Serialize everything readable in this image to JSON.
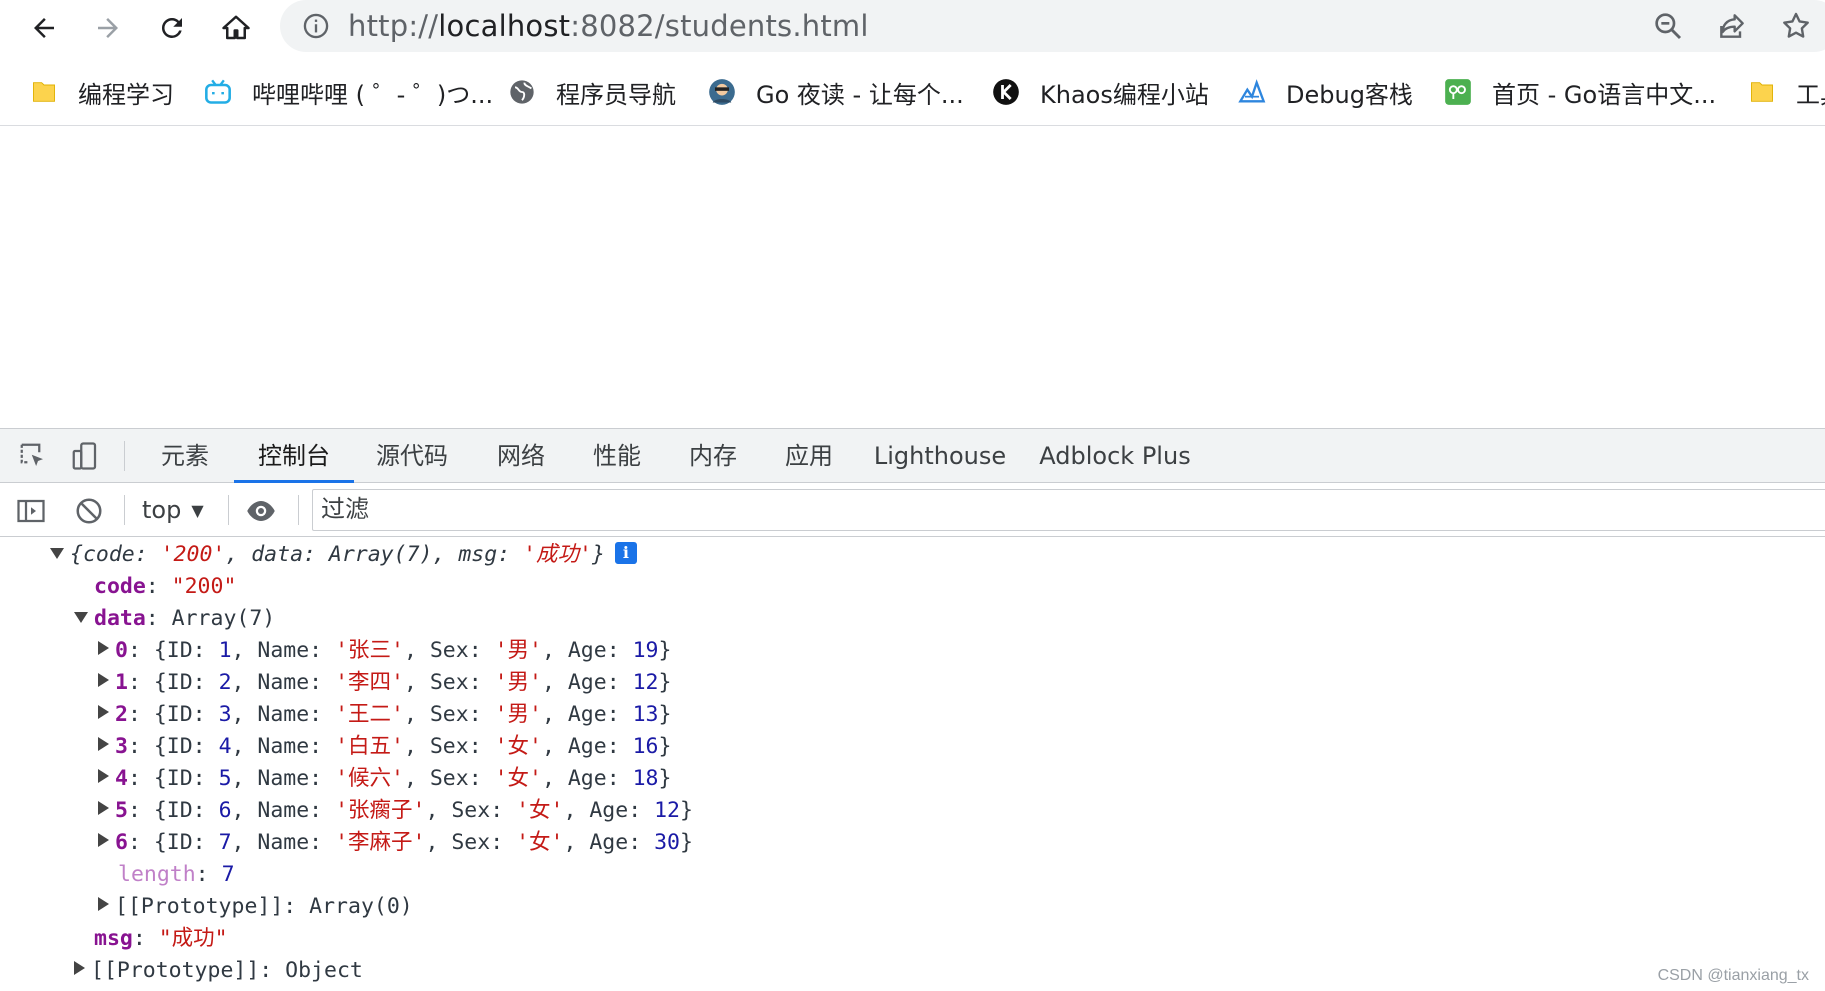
{
  "browser": {
    "url_prefix": "http://",
    "url_host": "localhost",
    "url_rest": ":8082/students.html",
    "bookmarks": [
      {
        "label": "编程学习",
        "icon": "folder-icon"
      },
      {
        "label": "哔哩哔哩 ( ゜- ゜)つ...",
        "icon": "bilibili-icon"
      },
      {
        "label": "程序员导航",
        "icon": "globe-icon"
      },
      {
        "label": "Go 夜读 - 让每个...",
        "icon": "avatar-icon"
      },
      {
        "label": "Khaos编程小站",
        "icon": "k-logo-icon"
      },
      {
        "label": "Debug客栈",
        "icon": "debug-logo-icon"
      },
      {
        "label": "首页 - Go语言中文...",
        "icon": "go-cn-icon"
      },
      {
        "label": "工具",
        "icon": "folder-icon"
      }
    ]
  },
  "devtools": {
    "tabs": [
      "元素",
      "控制台",
      "源代码",
      "网络",
      "性能",
      "内存",
      "应用",
      "Lighthouse",
      "Adblock Plus"
    ],
    "active_tab": "控制台",
    "context": "top",
    "filter_placeholder": "过滤"
  },
  "console": {
    "summary": {
      "code": "'200'",
      "data": "Array(7)",
      "msg": "'成功'"
    },
    "code_value": "\"200\"",
    "data_label": "Array(7)",
    "rows": [
      {
        "index": "0",
        "id": "1",
        "name": "'张三'",
        "sex": "'男'",
        "age": "19"
      },
      {
        "index": "1",
        "id": "2",
        "name": "'李四'",
        "sex": "'男'",
        "age": "12"
      },
      {
        "index": "2",
        "id": "3",
        "name": "'王二'",
        "sex": "'男'",
        "age": "13"
      },
      {
        "index": "3",
        "id": "4",
        "name": "'白五'",
        "sex": "'女'",
        "age": "16"
      },
      {
        "index": "4",
        "id": "5",
        "name": "'候六'",
        "sex": "'女'",
        "age": "18"
      },
      {
        "index": "5",
        "id": "6",
        "name": "'张瘸子'",
        "sex": "'女'",
        "age": "12"
      },
      {
        "index": "6",
        "id": "7",
        "name": "'李麻子'",
        "sex": "'女'",
        "age": "30"
      }
    ],
    "length_value": "7",
    "array_prototype": "Array(0)",
    "msg_value": "\"成功\"",
    "object_prototype": "Object"
  },
  "watermark": "CSDN @tianxiang_tx"
}
